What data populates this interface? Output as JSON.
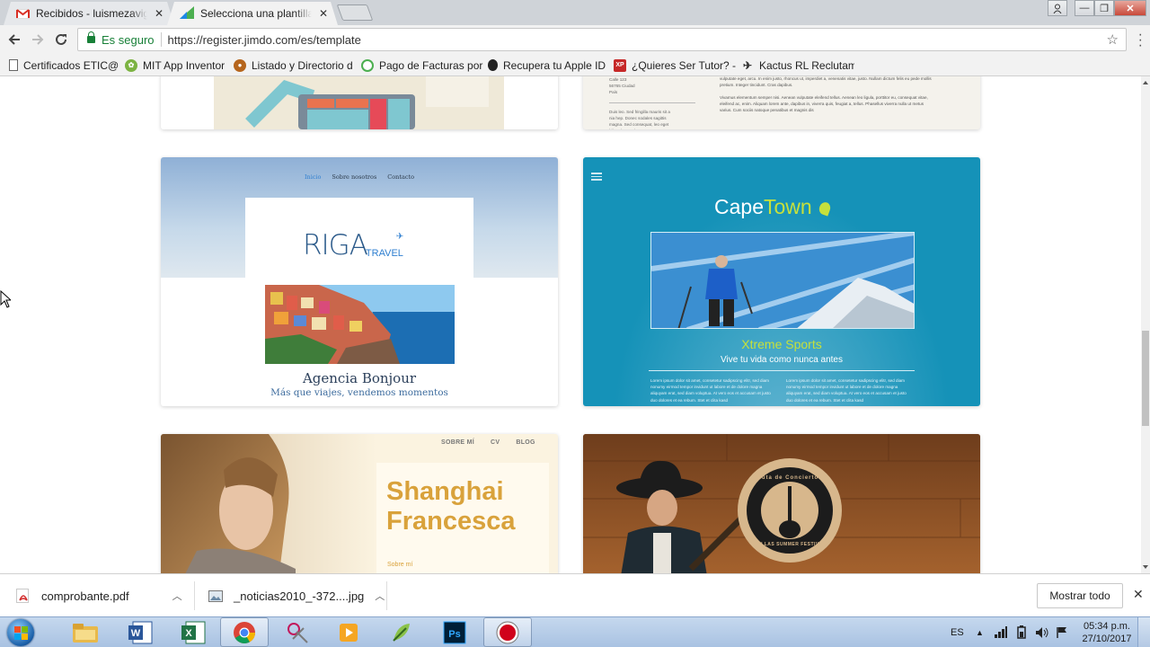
{
  "browser": {
    "tabs": [
      {
        "title": "Recibidos - luismezavige",
        "favicon": "gmail-icon"
      },
      {
        "title": "Selecciona una plantilla p",
        "favicon": "jimdo-icon"
      }
    ],
    "secure_label": "Es seguro",
    "url": "https://register.jimdo.com/es/template",
    "bookmarks": [
      "Certificados ETIC@",
      "MIT App Inventor",
      "Listado y Directorio d",
      "Pago de Facturas por",
      "Recupera tu Apple ID",
      "¿Quieres Ser Tutor? -",
      "Kactus RL Reclutamie"
    ]
  },
  "templates": {
    "top_right_text": {
      "address": [
        "Calle 123",
        "56765 Ciudad",
        "País"
      ],
      "body1": "pellentesque eu, pretium quis, sem. Nulla consequat massa quis enim. Donec pede justo, fringilla vel, aliquet nec, vulputate eget, arcu. In enim justo, rhoncus ut, imperdiet a, venenatis vitae, justo. Nullam dictum felis eu pede mollis pretium. Integer tincidunt. Cras dapibus.",
      "aside": "Duis leo. Sed fringilla mauris sit a nia hep. Donec sodales sagittis magna. Sed consequat, leo eget bibendum sed",
      "body2": "Vivamus elementum semper nisi. Aenean vulputate eleifend tellus. Aenean leo ligula, porttitor eu, consequat vitae, eleifend ac, enim. Aliquam lorem ante, dapibus in, viverra quis, feugiat a, tellus. Phasellus viverra nulla ut metus varius. Cum sociis natoque penatibus et magnis dis"
    },
    "riga": {
      "nav": [
        "Inicio",
        "Sobre nosotros",
        "Contacto"
      ],
      "logo_main": "RIGA",
      "logo_sub": "TRAVEL",
      "title": "Agencia Bonjour",
      "subtitle": "Más que viajes, vendemos momentos"
    },
    "capetown": {
      "logo_a": "Cape",
      "logo_b": "Town",
      "heading": "Xtreme Sports",
      "tagline": "Vive tu vida como nunca antes",
      "lorem_left": "Lorem ipsum dolor sit amet, consetetur sadipscing elitr, sed diam nonumy eirmod tempor invidunt ut labore et de dolore magna aliquyam erat, sed diam voluptua. At vero eos et accusam et justo duo dolores et ea rebum. Stet et clita kasd",
      "lorem_right": "Lorem ipsum dolor sit amet, consetetur sadipscing elitr, sed diam nonumy eirmod tempor invidunt ut labore et de dolore magna aliquyam erat, sed diam voluptua. At vero eos et accusam et justo duo dolores et ea rebum. Stet et clita kasd"
    },
    "shanghai": {
      "nav": [
        "SOBRE MÍ",
        "CV",
        "BLOG"
      ],
      "title_line1": "Shanghai",
      "title_line2": "Francesca",
      "about": "Sobre mí"
    },
    "music": {
      "badge_top": "Ruta de Conciertos",
      "badge_bottom": "DALLAS SUMMER FESTIVAL"
    }
  },
  "downloads": {
    "items": [
      {
        "name": "comprobante.pdf",
        "icon": "pdf-file-icon"
      },
      {
        "name": "_noticias2010_-372....jpg",
        "icon": "image-file-icon"
      }
    ],
    "show_all": "Mostrar todo"
  },
  "taskbar": {
    "lang": "ES",
    "time": "05:34 p.m.",
    "date": "27/10/2017"
  },
  "colors": {
    "secure_green": "#188038",
    "capetown_bg": "#1592b8",
    "capetown_accent": "#c6e03c",
    "shanghai_gold": "#d9a23b",
    "riga_blue": "#2b5a8a"
  }
}
